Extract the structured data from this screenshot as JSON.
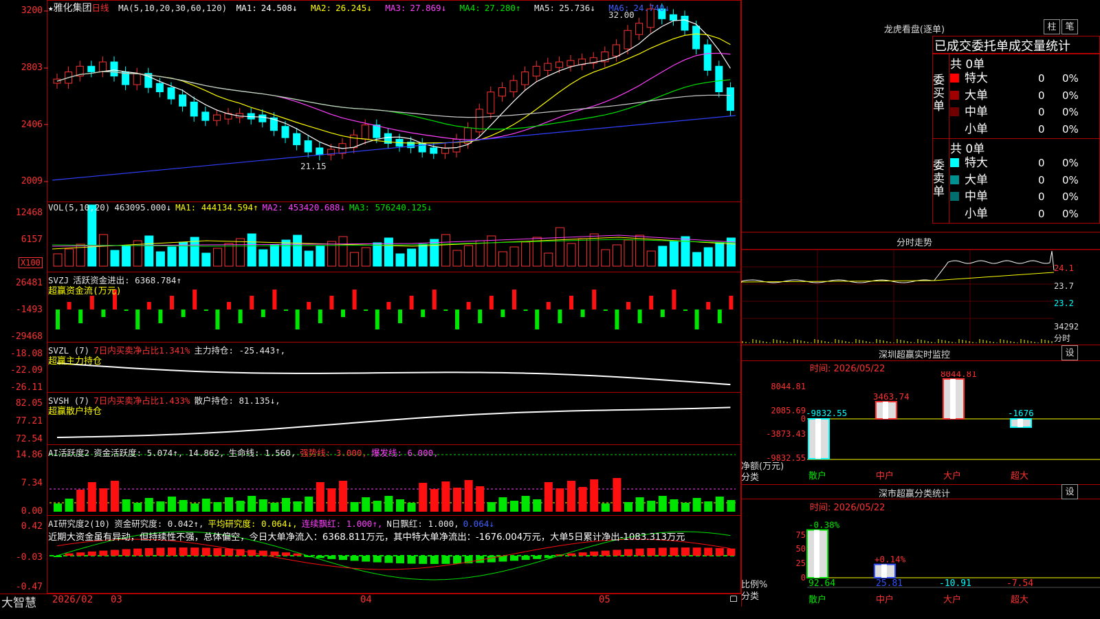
{
  "app": {
    "brand": "大智慧",
    "bottom_dates": [
      "2026/02",
      "03",
      "04",
      "05"
    ]
  },
  "main_chart": {
    "title_star": "★",
    "stock_name": "雅化集团",
    "period": "日线",
    "ma_label": "MA(5,10,20,30,60,120)",
    "ma": [
      {
        "name": "MA1:",
        "value": "24.508↓",
        "color": "#ffffff"
      },
      {
        "name": "MA2:",
        "value": "26.245↓",
        "color": "#ffff00"
      },
      {
        "name": "MA3:",
        "value": "27.869↓",
        "color": "#ff40ff"
      },
      {
        "name": "MA4:",
        "value": "27.280↑",
        "color": "#00e600"
      },
      {
        "name": "MA5:",
        "value": "25.736↓",
        "color": "#e8e8e8"
      },
      {
        "name": "MA6:",
        "value": "24.740↓",
        "color": "#4060ff"
      }
    ],
    "y_ticks": [
      "3200",
      "2803",
      "2406",
      "2009"
    ],
    "high_label": "32.00",
    "low_label": "21.15"
  },
  "vol": {
    "label": "VOL(5,10,20)",
    "value": "463095.000↓",
    "ma1": "MA1: 444134.594↑",
    "ma2": "MA2: 453420.688↓",
    "ma3": "MA3: 576240.125↓",
    "y_ticks": [
      "12468",
      "6157"
    ],
    "unit": "X100"
  },
  "svzj": {
    "label": "SVZJ",
    "text1": "活跃资金进出: 6368.784↑",
    "text2": "超赢资金流(万元)",
    "y_ticks": [
      "26481",
      "-1493",
      "-29468"
    ]
  },
  "svzl": {
    "label": "SVZL (7)",
    "text1": "7日内买卖净占比1.341%",
    "text2": "主力持仓: -25.443↑,",
    "text3": "超赢主力持仓",
    "y_ticks": [
      "-18.08",
      "-22.09",
      "-26.11"
    ]
  },
  "svsh": {
    "label": "SVSH (7)",
    "text1": "7日内买卖净占比1.433%",
    "text2": "散户持仓: 81.135↓,",
    "text3": "超赢散户持仓",
    "y_ticks": [
      "82.05",
      "77.21",
      "72.54"
    ]
  },
  "ai1": {
    "label": "AI活跃度2",
    "text1": "资金活跃度: 5.074↑, 14.862,",
    "text2": "生命线: 1.560,",
    "text3": "强势线: 3.000,",
    "text4": "爆发线: 6.000,",
    "y_ticks": [
      "14.86",
      "7.34",
      "0.00"
    ]
  },
  "ai2": {
    "label": "AI研究度2(10)",
    "text1": "资金研究度: 0.042↑,",
    "text2": "平均研究度: 0.064↓,",
    "text3": "连续飘红: 1.000↑,",
    "text4": "N日飘红: 1.000,",
    "text5": "0.064↓",
    "comment": "近期大资金虽有异动，但持续性不强，总体偏空，今日大单净流入：6368.811万元，其中特大单净流出：-1676.004万元，大单5日累计净出-1083.313万元",
    "y_ticks": [
      "0.42",
      "-0.03",
      "-0.47"
    ]
  },
  "dragon": {
    "title": "龙虎看盘(逐单)",
    "btn1": "柱",
    "btn2": "笔",
    "tabs": "已成交委托单成交量统计",
    "buy_label": "委买单",
    "sell_label": "委卖单",
    "buy_total": "共 0单",
    "sell_total": "共 0单",
    "buy_rows": [
      {
        "name": "特大",
        "v": "0",
        "p": "0%",
        "color": "#ff0000"
      },
      {
        "name": "大单",
        "v": "0",
        "p": "0%",
        "color": "#a00000"
      },
      {
        "name": "中单",
        "v": "0",
        "p": "0%",
        "color": "#700000"
      },
      {
        "name": "小单",
        "v": "0",
        "p": "0%",
        "color": ""
      }
    ],
    "sell_rows": [
      {
        "name": "特大",
        "v": "0",
        "p": "0%",
        "color": "#00ffff"
      },
      {
        "name": "大单",
        "v": "0",
        "p": "0%",
        "color": "#009090"
      },
      {
        "name": "中单",
        "v": "0",
        "p": "0%",
        "color": "#006e6e"
      },
      {
        "name": "小单",
        "v": "0",
        "p": "0%",
        "color": ""
      }
    ]
  },
  "intraday": {
    "title": "分时走势",
    "ticks": [
      "24.1",
      "23.7",
      "23.2",
      "34292",
      "分时"
    ]
  },
  "sz_monitor": {
    "title": "深圳超赢实时监控",
    "btn": "设",
    "time": "时间: 2026/05/22",
    "y_ticks": [
      "8044.81",
      "2085.69",
      "0",
      "-3873.43",
      "-9832.55"
    ],
    "ylabel": "净额(万元)",
    "xlabel": "分类",
    "bars": [
      {
        "cat": "散户",
        "value": -9832.55,
        "label": "-9832.55",
        "color": "#00ffff"
      },
      {
        "cat": "中户",
        "value": 3463.74,
        "label": "3463.74",
        "color": "#ff3232"
      },
      {
        "cat": "大户",
        "value": 8044.81,
        "label": "8044.81",
        "color": "#ff3232"
      },
      {
        "cat": "超大",
        "value": -1676,
        "label": "-1676",
        "color": "#00ffff"
      }
    ]
  },
  "sz_stat": {
    "title": "深市超赢分类统计",
    "btn": "设",
    "time": "时间: 2026/05/22",
    "y_ticks": [
      "75",
      "50",
      "25",
      "0"
    ],
    "ylabel": "比例%",
    "xlabel": "分类",
    "bars": [
      {
        "cat": "散户",
        "value": 92.64,
        "label": "92.64",
        "top": "-0.38%",
        "cat_color": "#00e600",
        "color": "#00e600"
      },
      {
        "cat": "中户",
        "value": 25.81,
        "label": "25.81",
        "top": "+0.14%",
        "cat_color": "#ff3232",
        "color": "#3050ff"
      },
      {
        "cat": "大户",
        "value": -10.91,
        "label": "-10.91",
        "top": "",
        "cat_color": "#ff3232",
        "color": "#00ffff"
      },
      {
        "cat": "超大",
        "value": -7.54,
        "label": "-7.54",
        "top": "",
        "cat_color": "#ff3232",
        "color": "#ff3232"
      }
    ]
  }
}
